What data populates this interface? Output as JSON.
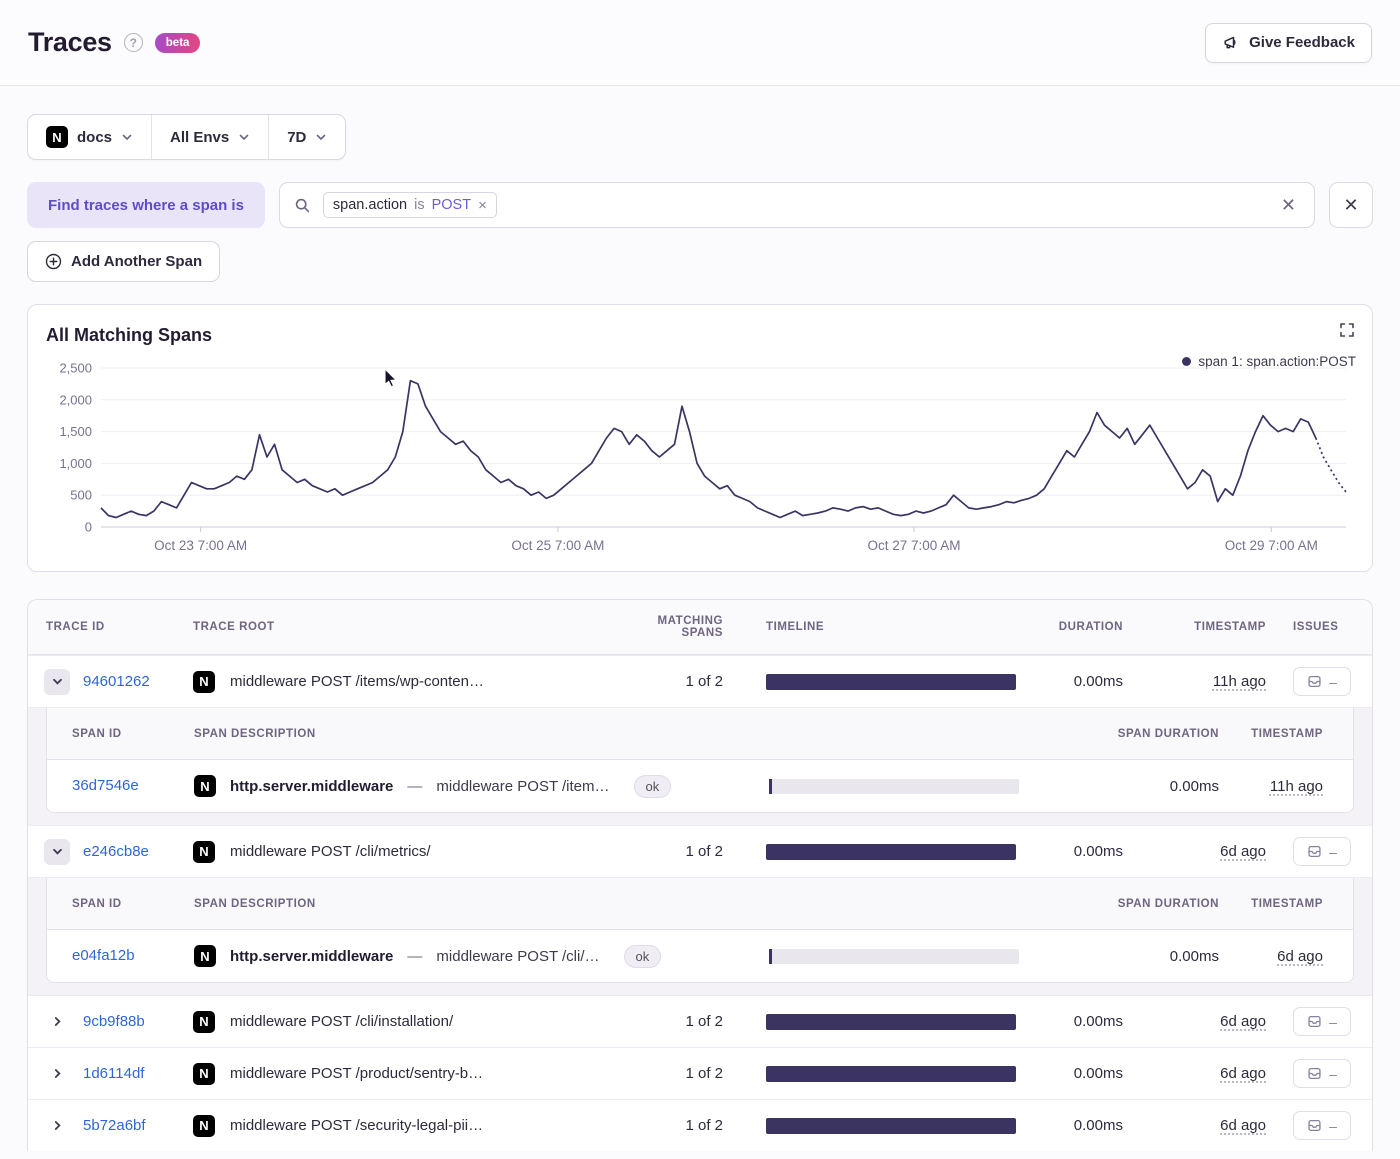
{
  "page": {
    "title": "Traces",
    "beta_label": "beta",
    "help_icon": "?"
  },
  "header": {
    "feedback_button": "Give Feedback"
  },
  "filters": {
    "project": {
      "label": "docs",
      "platform_icon": "N"
    },
    "environment": "All Envs",
    "period": "7D"
  },
  "span_query": {
    "label": "Find traces where a span is",
    "token": {
      "key": "span.action",
      "op": "is",
      "value": "POST"
    },
    "add_button": "Add Another Span"
  },
  "chart": {
    "title": "All Matching Spans",
    "legend": "span 1: span.action:POST"
  },
  "chart_data": {
    "type": "line",
    "title": "All Matching Spans",
    "legend": [
      "span 1: span.action:POST"
    ],
    "legend_position": "top-right",
    "line_color": "#3b3462",
    "grid_color": "#f1eef4",
    "axis_color": "#cdc8d6",
    "tick_text_color": "#7a7190",
    "ylim": [
      0,
      2500
    ],
    "y_ticks": [
      "0",
      "500",
      "1,000",
      "1,500",
      "2,000",
      "2,500"
    ],
    "x_ticks": [
      "Oct 23 7:00 AM",
      "Oct 25 7:00 AM",
      "Oct 27 7:00 AM",
      "Oct 29 7:00 AM"
    ],
    "dotted_tail": 5,
    "values": [
      300,
      180,
      150,
      200,
      250,
      200,
      180,
      250,
      400,
      350,
      300,
      500,
      700,
      650,
      600,
      600,
      650,
      700,
      800,
      750,
      900,
      1450,
      1100,
      1300,
      900,
      800,
      700,
      750,
      650,
      600,
      550,
      600,
      500,
      550,
      600,
      650,
      700,
      800,
      900,
      1100,
      1500,
      2300,
      2250,
      1900,
      1700,
      1500,
      1400,
      1300,
      1350,
      1200,
      1100,
      900,
      800,
      700,
      750,
      650,
      600,
      500,
      550,
      450,
      500,
      600,
      700,
      800,
      900,
      1000,
      1200,
      1400,
      1550,
      1500,
      1300,
      1450,
      1350,
      1200,
      1100,
      1200,
      1300,
      1900,
      1500,
      1000,
      800,
      700,
      600,
      650,
      500,
      450,
      400,
      300,
      250,
      200,
      150,
      200,
      250,
      180,
      200,
      220,
      250,
      300,
      280,
      250,
      300,
      320,
      280,
      300,
      250,
      200,
      180,
      200,
      250,
      220,
      250,
      300,
      350,
      500,
      400,
      300,
      280,
      300,
      320,
      350,
      400,
      380,
      420,
      450,
      500,
      600,
      800,
      1000,
      1200,
      1100,
      1300,
      1500,
      1800,
      1600,
      1500,
      1400,
      1550,
      1300,
      1450,
      1600,
      1400,
      1200,
      1000,
      800,
      600,
      700,
      900,
      800,
      400,
      600,
      500,
      800,
      1200,
      1500,
      1750,
      1600,
      1500,
      1550,
      1500,
      1700,
      1650,
      1400,
      1100,
      900,
      700,
      550
    ]
  },
  "table": {
    "columns": [
      "TRACE ID",
      "TRACE ROOT",
      "MATCHING SPANS",
      "TIMELINE",
      "DURATION",
      "TIMESTAMP",
      "ISSUES"
    ],
    "span_columns": [
      "SPAN ID",
      "SPAN DESCRIPTION",
      "SPAN DURATION",
      "TIMESTAMP"
    ],
    "bar_color": "#3b3462",
    "rows": [
      {
        "trace_id": "94601262",
        "platform_icon": "N",
        "root": "middleware POST /items/wp-conten…",
        "matching": "1 of 2",
        "duration": "0.00ms",
        "timestamp": "11h ago",
        "issues": "–",
        "spans": [
          {
            "span_id": "36d7546e",
            "platform_icon": "N",
            "op": "http.server.middleware",
            "dash": "—",
            "description": "middleware POST /item…",
            "status": "ok",
            "duration": "0.00ms",
            "timestamp": "11h ago"
          }
        ]
      },
      {
        "trace_id": "e246cb8e",
        "platform_icon": "N",
        "root": "middleware POST /cli/metrics/",
        "matching": "1 of 2",
        "duration": "0.00ms",
        "timestamp": "6d ago",
        "issues": "–",
        "spans": [
          {
            "span_id": "e04fa12b",
            "platform_icon": "N",
            "op": "http.server.middleware",
            "dash": "—",
            "description": "middleware POST /cli/…",
            "status": "ok",
            "duration": "0.00ms",
            "timestamp": "6d ago"
          }
        ]
      },
      {
        "trace_id": "9cb9f88b",
        "platform_icon": "N",
        "root": "middleware POST /cli/installation/",
        "matching": "1 of 2",
        "duration": "0.00ms",
        "timestamp": "6d ago",
        "issues": "–"
      },
      {
        "trace_id": "1d6114df",
        "platform_icon": "N",
        "root": "middleware POST /product/sentry-b…",
        "matching": "1 of 2",
        "duration": "0.00ms",
        "timestamp": "6d ago",
        "issues": "–"
      },
      {
        "trace_id": "5b72a6bf",
        "platform_icon": "N",
        "root": "middleware POST /security-legal-pii…",
        "matching": "1 of 2",
        "duration": "0.00ms",
        "timestamp": "6d ago",
        "issues": "–"
      }
    ]
  },
  "colors": {
    "accent_purple": "#5f4dc6",
    "link_blue": "#2e66d8",
    "navy": "#3b3462",
    "beta_gradient_from": "#a44bc9",
    "beta_gradient_to": "#e4477e"
  }
}
